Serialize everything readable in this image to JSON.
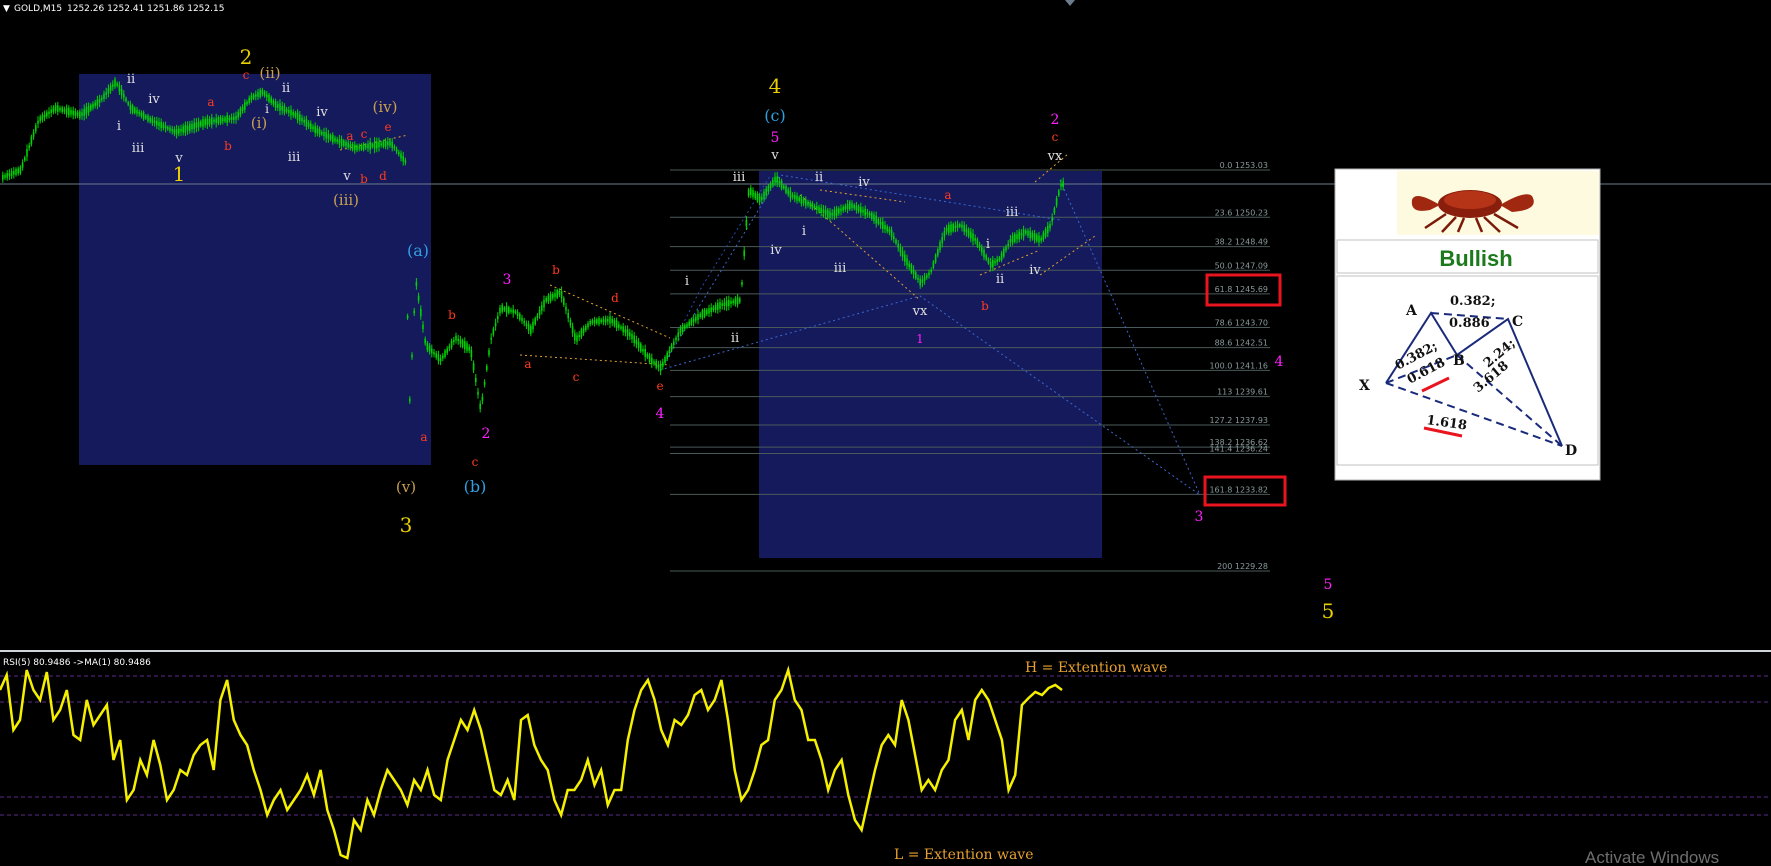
{
  "header": {
    "symbol": "GOLD,M15",
    "ohlc": "1252.26 1252.41 1251.86 1252.15"
  },
  "rsi_header": "RSI(5) 80.9486  ->MA(1) 80.9486",
  "rsi_notes": {
    "high": "H = Extention wave",
    "low": "L = Extention wave"
  },
  "watermark": "Activate Windows",
  "pattern": {
    "title": "Bullish",
    "points": [
      "X",
      "A",
      "B",
      "C",
      "D"
    ],
    "ratios": [
      "0.382;",
      "0.886",
      "0.382;",
      "0.618",
      "2.24;",
      "3.618",
      "1.618"
    ]
  },
  "colors": {
    "candle": "#00d400",
    "rsi": "#f5f000",
    "box": "#151a5c",
    "fib": "#4a5a5a",
    "highlight": "#e8141e",
    "yellow_label": "#e8d000",
    "orange_label": "#c8a050",
    "red_label": "#ff3b1f",
    "cyan_label": "#30a0e0",
    "magenta_label": "#ff20ff",
    "white_label": "#e0e0e0"
  },
  "chart_data": {
    "type": "candlestick",
    "symbol": "GOLD",
    "timeframe": "M15",
    "fib_levels": [
      {
        "ratio": "0.0",
        "price": 1253.03
      },
      {
        "ratio": "23.6",
        "price": 1250.23
      },
      {
        "ratio": "38.2",
        "price": 1248.49
      },
      {
        "ratio": "50.0",
        "price": 1247.09
      },
      {
        "ratio": "61.8",
        "price": 1245.69
      },
      {
        "ratio": "78.6",
        "price": 1243.7
      },
      {
        "ratio": "88.6",
        "price": 1242.51
      },
      {
        "ratio": "100.0",
        "price": 1241.16
      },
      {
        "ratio": "113",
        "price": 1239.61
      },
      {
        "ratio": "127.2",
        "price": 1237.93
      },
      {
        "ratio": "138.2",
        "price": 1236.62
      },
      {
        "ratio": "141.4",
        "price": 1236.24
      },
      {
        "ratio": "161.8",
        "price": 1233.82
      },
      {
        "ratio": "200",
        "price": 1229.28
      }
    ],
    "highlighted_levels": [
      "61.8",
      "161.8"
    ],
    "indicator": {
      "name": "RSI",
      "period": 5,
      "value": 80.9486,
      "ma_period": 1,
      "ma_value": 80.9486
    },
    "wave_labels": [
      "1",
      "2",
      "3",
      "4",
      "5",
      "(i)",
      "(ii)",
      "(iii)",
      "(iv)",
      "(v)",
      "(a)",
      "(b)",
      "(c)",
      "i",
      "ii",
      "iii",
      "iv",
      "v",
      "vx",
      "a",
      "b",
      "c",
      "d",
      "e"
    ]
  }
}
